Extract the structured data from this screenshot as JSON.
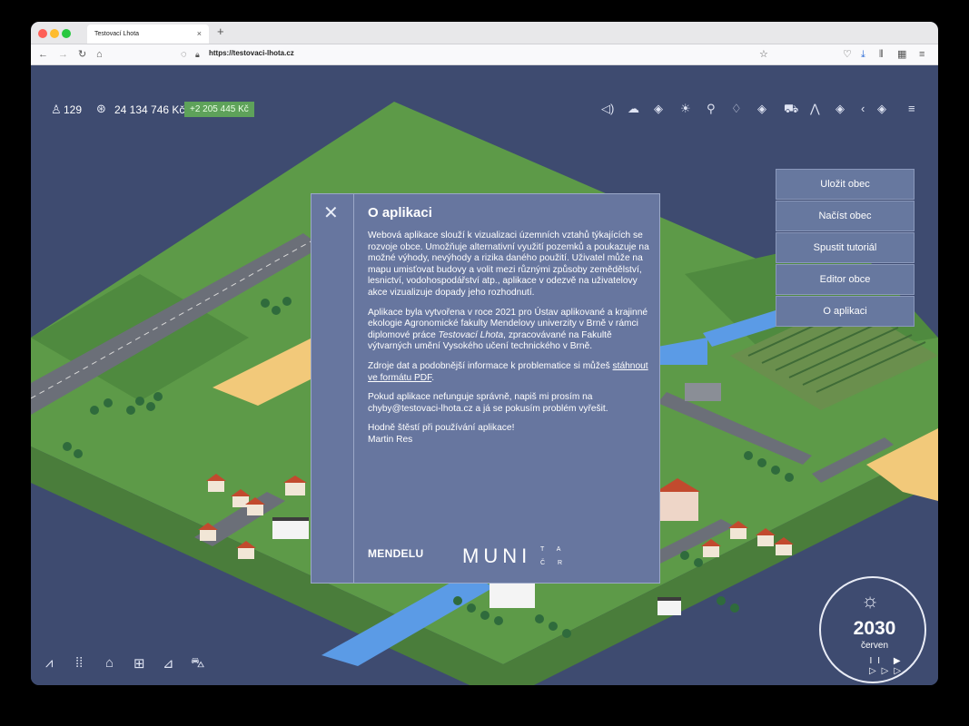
{
  "browser": {
    "tab_title": "Testovací Lhota",
    "tab_close": "×",
    "new_tab": "+",
    "url": "https://testovaci-lhota.cz",
    "colors": {
      "close": "#fe5f57",
      "min": "#febc2e",
      "max": "#28c840"
    }
  },
  "hud": {
    "population": "129",
    "budget": "24 134 746 Kč",
    "budget_delta": "+2 205 445 Kč"
  },
  "top_toolbar_icons": [
    "sound-icon",
    "cloud-icon",
    "layer-icon",
    "sun-bulb-icon",
    "pipe-icon",
    "drop-icon",
    "eye-icon",
    "car-icon",
    "mountain-icon",
    "layer2-icon",
    "chevron-left-icon",
    "layers-icon",
    "hamburger-icon"
  ],
  "menu": {
    "items": [
      "Uložit obec",
      "Načíst obec",
      "Spustit tutoriál",
      "Editor obce",
      "O aplikaci"
    ]
  },
  "modal": {
    "close": "✕",
    "title": "O aplikaci",
    "p1": "Webová aplikace slouží k vizualizaci územních vztahů týkajících se rozvoje obce. Umožňuje alternativní využití pozemků a poukazuje na možné výhody, nevýhody a rizika daného použití. Uživatel může na mapu umisťovat budovy a volit mezi různými způsoby zemědělství, lesnictví, vodohospodářství atp., aplikace v odezvě na uživatelovy akce vizualizuje dopady jeho rozhodnutí.",
    "p2a": "Aplikace byla vytvořena v roce 2021 pro Ústav aplikované a krajinné ekologie Agronomické fakulty Mendelovy univerzity v Brně v rámci diplomové práce ",
    "p2b": "Testovací Lhota",
    "p2c": ", zpracovávané na Fakultě výtvarných umění Vysokého učení technického v Brně.",
    "p3a": "Zdroje dat a podobnější informace k problematice si můžeš ",
    "p3_link": "stáhnout ve formátu PDF",
    "p3b": ".",
    "p4": "Pokud aplikace nefunguje správně, napiš mi prosím na chyby@testovaci-lhota.cz a já se pokusím problém vyřešit.",
    "p5a": "Hodně štěstí při používání aplikace!",
    "p5b": "Martin Res",
    "logo_mendelu": "MENDELU",
    "logo_muni": "MUNI",
    "logo_tacr_top": "TA",
    "logo_tacr_bottom": "ČR"
  },
  "clock": {
    "year": "2030",
    "month": "červen",
    "controls": "II ▶ ▷▷▷"
  },
  "bottom_toolbar_icons": [
    "terrain-icon",
    "crops-icon",
    "house-icon",
    "shop-icon",
    "factory-icon",
    "tractor-icon"
  ]
}
